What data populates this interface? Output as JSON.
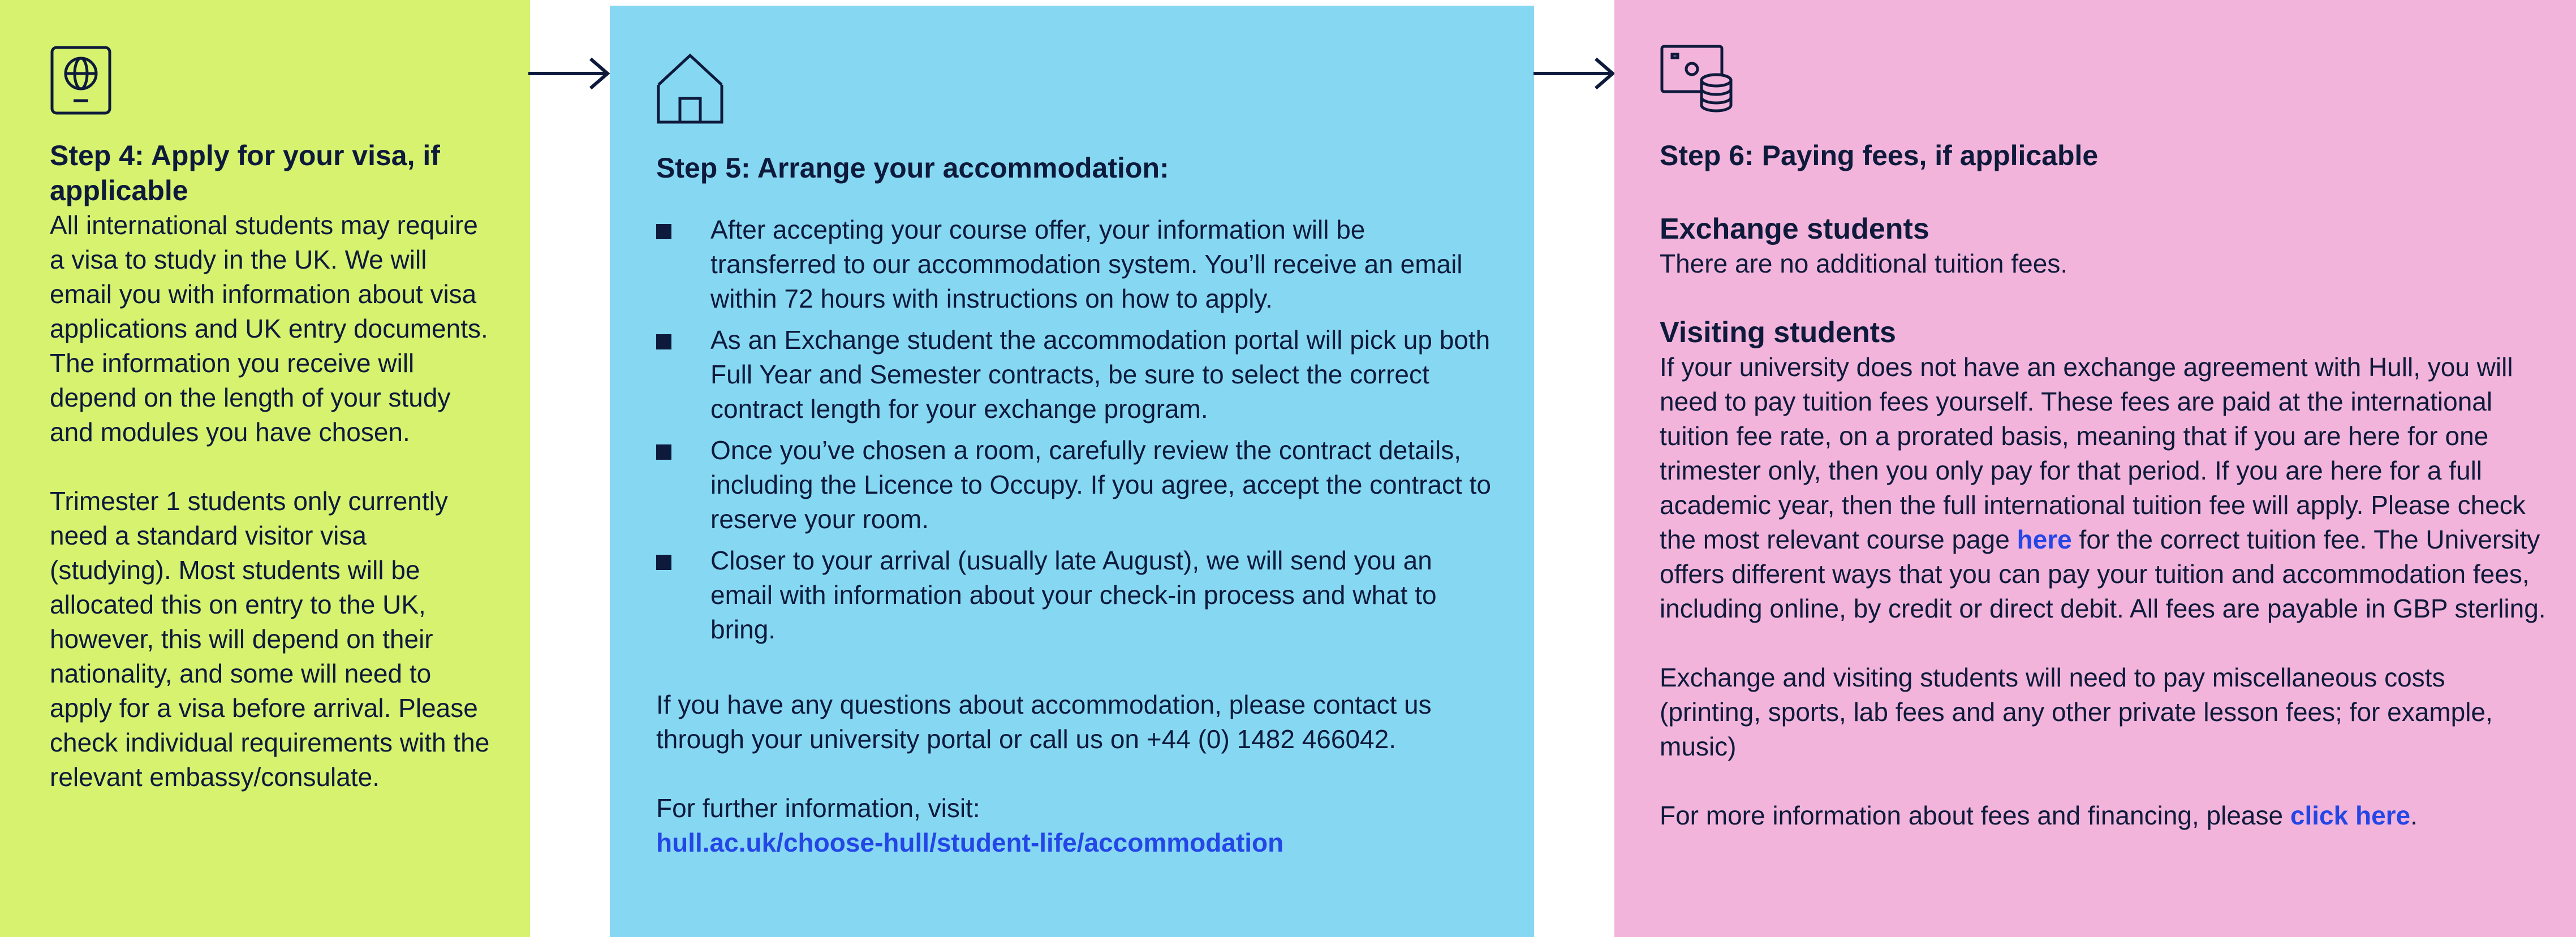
{
  "colors": {
    "panel_green": "#d6f26e",
    "panel_blue": "#86d8f2",
    "panel_pink": "#f2b4da",
    "text_navy": "#0e1a3c",
    "link_blue": "#2446e6"
  },
  "step4": {
    "icon": "passport-icon",
    "title": "Step 4: Apply for your visa, if applicable",
    "para1": "All international students may require a visa to study in the UK. We will email you with information about visa applications and UK entry documents. The information you receive will depend on the length of your study and modules you have chosen.",
    "para2": "Trimester 1 students only currently need a standard visitor visa (studying). Most students will be allocated this on entry to the UK, however, this will depend on their nationality, and some will need to apply for a visa before arrival. Please check individual requirements with the relevant embassy/consulate."
  },
  "step5": {
    "icon": "house-icon",
    "title": "Step 5: Arrange your accommodation:",
    "bullets": [
      "After accepting your course offer, your information will be transferred to our accommodation system. You’ll receive an email within 72 hours with instructions on how to apply.",
      "As an Exchange student the accommodation portal will pick up both Full Year and Semester contracts, be sure to select the correct contract length for your exchange program.",
      "Once you’ve chosen a room, carefully review the contract details, including the Licence to Occupy. If you agree, accept the contract to reserve your room.",
      "Closer to your arrival (usually late August), we will send you an email with information about your check-in process and what to bring."
    ],
    "questions": "If you have any questions about accommodation, please contact us through your university portal or call us on +44 (0) 1482 466042.",
    "further_label": "For further information, visit:",
    "further_link": "hull.ac.uk/choose-hull/student-life/accommodation"
  },
  "step6": {
    "icon": "money-coins-icon",
    "title": "Step 6: Paying fees, if applicable",
    "exchange_heading": "Exchange students",
    "exchange_text": "There are no additional tuition fees.",
    "visiting_heading": "Visiting students",
    "visiting_text_before": "If your university does not have an exchange agreement with Hull, you will need to pay tuition fees yourself. These fees are paid at the international tuition fee rate, on a prorated basis, meaning that if you are here for one trimester only, then you only pay for that period. If you are here for a full academic year, then the full international tuition fee will apply. Please check the most relevant course page ",
    "visiting_link": "here",
    "visiting_text_after": " for the correct tuition fee. The University offers different ways that you can pay your tuition and accommodation fees, including online, by credit or direct debit. All fees are payable in GBP sterling.",
    "misc_text": "Exchange and visiting students will need to pay miscellaneous costs (printing, sports, lab fees and any other private lesson fees; for example, music)",
    "more_info_before": "For more information about fees and financing, please ",
    "more_info_link": "click here",
    "more_info_after": "."
  }
}
